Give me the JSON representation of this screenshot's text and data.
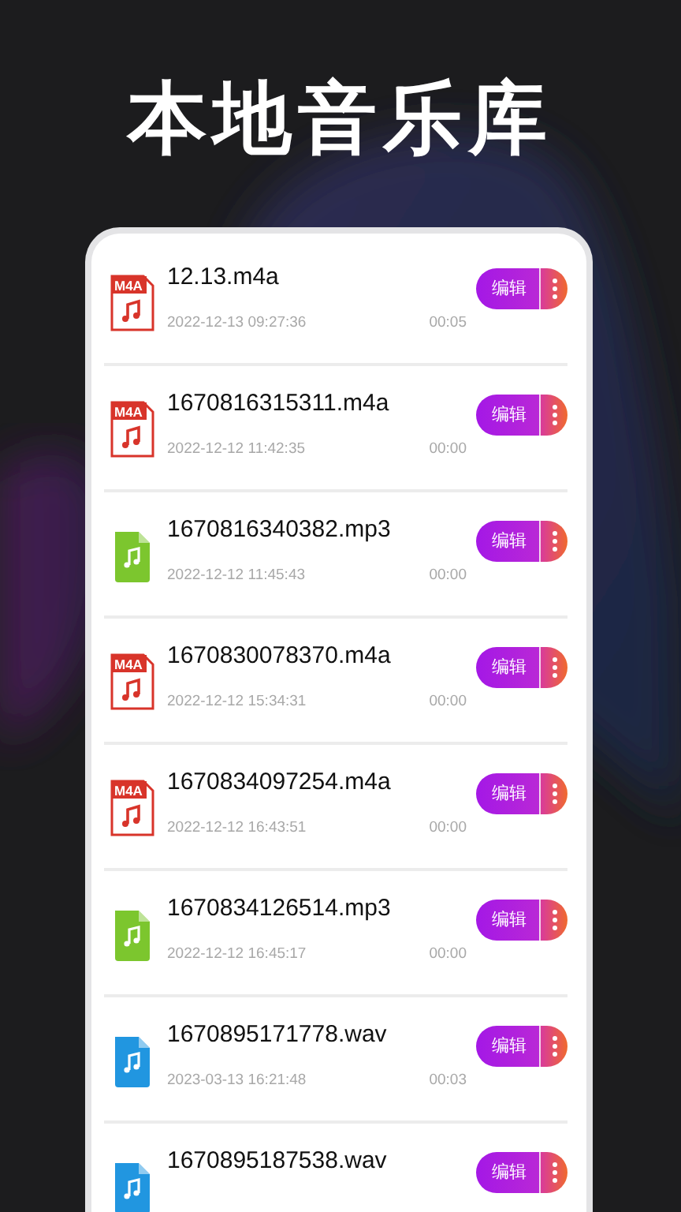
{
  "title": "本地音乐库",
  "files": [
    {
      "kind": "m4a",
      "icon_label": "M4A",
      "name": "12.13.m4a",
      "date": "2022-12-13 09:27:36",
      "duration": "00:05",
      "edit": "编辑"
    },
    {
      "kind": "m4a",
      "icon_label": "M4A",
      "name": "1670816315311.m4a",
      "date": "2022-12-12 11:42:35",
      "duration": "00:00",
      "edit": "编辑"
    },
    {
      "kind": "mp3",
      "name": "1670816340382.mp3",
      "date": "2022-12-12 11:45:43",
      "duration": "00:00",
      "edit": "编辑"
    },
    {
      "kind": "m4a",
      "icon_label": "M4A",
      "name": "1670830078370.m4a",
      "date": "2022-12-12 15:34:31",
      "duration": "00:00",
      "edit": "编辑"
    },
    {
      "kind": "m4a",
      "icon_label": "M4A",
      "name": "1670834097254.m4a",
      "date": "2022-12-12 16:43:51",
      "duration": "00:00",
      "edit": "编辑"
    },
    {
      "kind": "mp3",
      "name": "1670834126514.mp3",
      "date": "2022-12-12 16:45:17",
      "duration": "00:00",
      "edit": "编辑"
    },
    {
      "kind": "wav",
      "name": "1670895171778.wav",
      "date": "2023-03-13 16:21:48",
      "duration": "00:03",
      "edit": "编辑"
    },
    {
      "kind": "wav",
      "name": "1670895187538.wav",
      "edit": "编辑"
    }
  ]
}
